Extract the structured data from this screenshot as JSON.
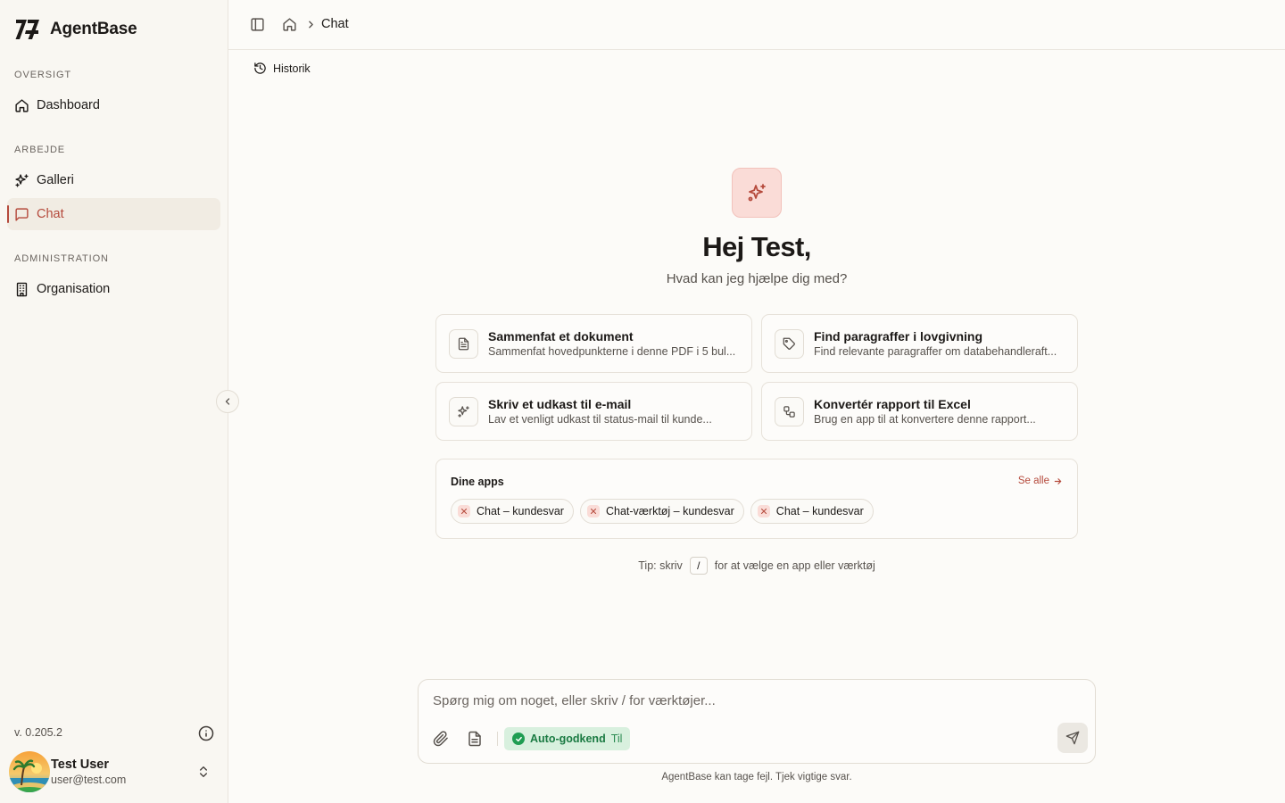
{
  "app": {
    "name": "AgentBase"
  },
  "sidebar": {
    "sections": [
      {
        "label": "OVERSIGT"
      },
      {
        "label": "ARBEJDE"
      },
      {
        "label": "ADMINISTRATION"
      }
    ],
    "items": [
      {
        "label": "Dashboard",
        "icon": "home-icon"
      },
      {
        "label": "Galleri",
        "icon": "sparkles-icon"
      },
      {
        "label": "Chat",
        "icon": "message-square-icon",
        "active": true
      },
      {
        "label": "Organisation",
        "icon": "building-icon"
      }
    ],
    "version": "v. 0.205.2",
    "user": {
      "name": "Test User",
      "email": "user@test.com"
    }
  },
  "header": {
    "breadcrumb": {
      "current": "Chat"
    }
  },
  "history": {
    "label": "Historik"
  },
  "hero": {
    "title": "Hej Test,",
    "subtitle": "Hvad kan jeg hjælpe dig med?"
  },
  "suggestions": [
    {
      "title": "Sammenfat et dokument",
      "description": "Sammenfat hovedpunkterne i denne PDF i 5 bul...",
      "icon": "file-text-icon"
    },
    {
      "title": "Find paragraffer i lovgivning",
      "description": "Find relevante paragraffer om databehandleraft...",
      "icon": "tag-icon"
    },
    {
      "title": "Skriv et udkast til e-mail",
      "description": "Lav et venligt udkast til status-mail til kunde...",
      "icon": "sparkles-icon"
    },
    {
      "title": "Konvertér rapport til Excel",
      "description": "Brug en app til at konvertere denne rapport...",
      "icon": "workflow-icon"
    }
  ],
  "apps": {
    "heading": "Dine apps",
    "see_all": "Se alle",
    "items": [
      {
        "label": "Chat – kundesvar"
      },
      {
        "label": "Chat-værktøj – kundesvar"
      },
      {
        "label": "Chat – kundesvar"
      }
    ]
  },
  "tip": {
    "prefix": "Tip: skriv",
    "key": "/",
    "suffix": "for at vælge en app eller værktøj"
  },
  "composer": {
    "placeholder": "Spørg mig om noget, eller skriv / for værktøjer...",
    "value": "",
    "auto_approve": {
      "label": "Auto-godkend",
      "state": "Til"
    },
    "disclaimer": "AgentBase kan tage fejl. Tjek vigtige svar."
  },
  "colors": {
    "accent": "#b54a3c",
    "accent_soft": "#fadcd7",
    "success": "#1f9d52",
    "success_soft": "#d8f0de",
    "background": "#fcfbf8",
    "sidebar": "#f9f7f2"
  }
}
